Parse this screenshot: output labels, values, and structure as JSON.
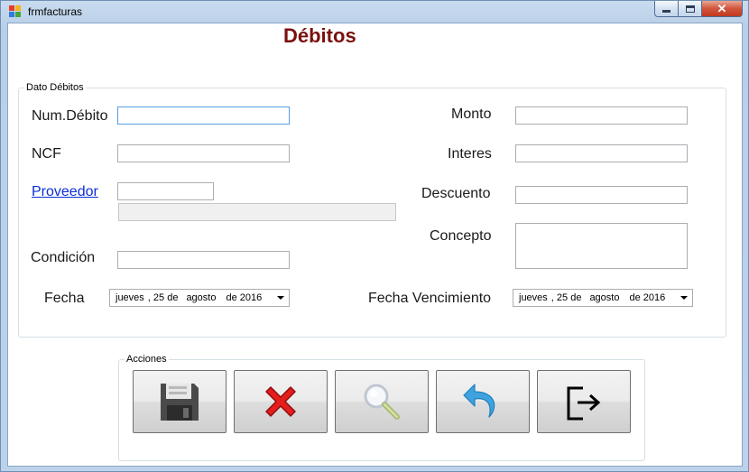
{
  "window": {
    "title": "frmfacturas"
  },
  "form": {
    "heading": "Débitos",
    "group_datos": "Dato Débitos",
    "group_acciones": "Acciones"
  },
  "labels": {
    "num_debito": "Num.Débito",
    "ncf": "NCF",
    "proveedor": "Proveedor",
    "condicion": "Condición",
    "fecha": "Fecha",
    "monto": "Monto",
    "interes": "Interes",
    "descuento": "Descuento",
    "concepto": "Concepto",
    "fecha_vencimiento": "Fecha Vencimiento"
  },
  "fields": {
    "num_debito": "",
    "ncf": "",
    "proveedor_code": "",
    "proveedor_name": "",
    "condicion": "",
    "monto": "",
    "interes": "",
    "descuento": "",
    "concepto": ""
  },
  "dates": {
    "fecha": {
      "weekday": "jueves",
      "day": ", 25 de",
      "month": "agosto",
      "year": "de 2016"
    },
    "fecha_vencimiento": {
      "weekday": "jueves",
      "day": ", 25 de",
      "month": "agosto",
      "year": "de 2016"
    }
  },
  "actions": [
    {
      "name": "save-button",
      "icon": "floppy-disk-icon"
    },
    {
      "name": "cancel-button",
      "icon": "red-x-icon"
    },
    {
      "name": "search-button",
      "icon": "magnifier-icon"
    },
    {
      "name": "undo-button",
      "icon": "undo-arrow-icon"
    },
    {
      "name": "exit-button",
      "icon": "exit-door-icon"
    }
  ],
  "colors": {
    "heading": "#7b1010",
    "link": "#0a2fd6",
    "focus_border": "#569de5"
  }
}
